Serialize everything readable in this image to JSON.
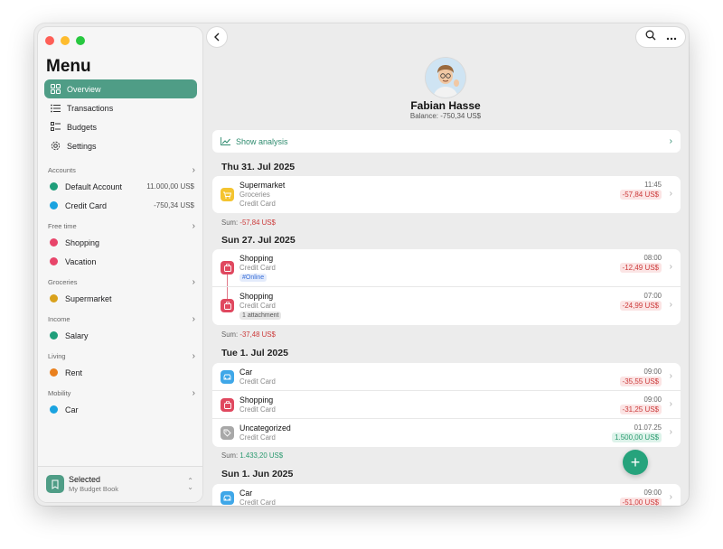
{
  "sidebar": {
    "title": "Menu",
    "nav": [
      {
        "label": "Overview",
        "icon": "grid-icon",
        "active": true
      },
      {
        "label": "Transactions",
        "icon": "list-icon"
      },
      {
        "label": "Budgets",
        "icon": "checklist-icon"
      },
      {
        "label": "Settings",
        "icon": "gear-icon"
      }
    ],
    "groups": [
      {
        "name": "Accounts",
        "items": [
          {
            "label": "Default Account",
            "amount": "11.000,00 US$",
            "color": "#1f9e7a"
          },
          {
            "label": "Credit Card",
            "amount": "-750,34 US$",
            "color": "#1aa3e0"
          }
        ]
      },
      {
        "name": "Free time",
        "items": [
          {
            "label": "Shopping",
            "color": "#e8456a"
          },
          {
            "label": "Vacation",
            "color": "#e8456a"
          }
        ]
      },
      {
        "name": "Groceries",
        "items": [
          {
            "label": "Supermarket",
            "color": "#d9a11c"
          }
        ]
      },
      {
        "name": "Income",
        "items": [
          {
            "label": "Salary",
            "color": "#1f9e7a"
          }
        ]
      },
      {
        "name": "Living",
        "items": [
          {
            "label": "Rent",
            "color": "#e9801e"
          }
        ]
      },
      {
        "name": "Mobility",
        "items": [
          {
            "label": "Car",
            "color": "#1aa3e0"
          }
        ]
      }
    ],
    "footer": {
      "title": "Selected",
      "subtitle": "My Budget Book"
    }
  },
  "profile": {
    "name": "Fabian Hasse",
    "balance": "Balance: -750,34 US$"
  },
  "analysis_label": "Show analysis",
  "days": [
    {
      "date": "Thu 31. Jul 2025",
      "sum_label": "Sum:",
      "sum": "-57,84 US$",
      "rows": [
        {
          "title": "Supermarket",
          "sub1": "Groceries",
          "sub2": "Credit Card",
          "time": "11:45",
          "amount": "-57,84 US$",
          "icon": "cart-icon"
        }
      ]
    },
    {
      "date": "Sun 27. Jul 2025",
      "sum_label": "Sum:",
      "sum": "-37,48 US$",
      "rows": [
        {
          "title": "Shopping",
          "sub1": "Credit Card",
          "tag": "#Online",
          "time": "08:00",
          "amount": "-12,49 US$",
          "icon": "bag-icon"
        },
        {
          "title": "Shopping",
          "sub1": "Credit Card",
          "tag": "1 attachment",
          "time": "07:00",
          "amount": "-24,99 US$",
          "icon": "bag-icon"
        }
      ]
    },
    {
      "date": "Tue 1. Jul 2025",
      "sum_label": "Sum:",
      "sum": "1.433,20 US$",
      "rows": [
        {
          "title": "Car",
          "sub1": "Credit Card",
          "time": "09:00",
          "amount": "-35,55 US$",
          "icon": "car-icon"
        },
        {
          "title": "Shopping",
          "sub1": "Credit Card",
          "time": "09:00",
          "amount": "-31,25 US$",
          "icon": "bag-icon"
        },
        {
          "title": "Uncategorized",
          "sub1": "Credit Card",
          "time": "01.07.25",
          "amount": "1.500,00 US$",
          "icon": "tag-icon"
        }
      ]
    },
    {
      "date": "Sun 1. Jun 2025",
      "rows": [
        {
          "title": "Car",
          "sub1": "Credit Card",
          "time": "09:00",
          "amount": "-51,00 US$",
          "icon": "car-icon"
        }
      ]
    }
  ],
  "colors": {
    "accent": "#4f9d86",
    "fab": "#26a37c",
    "negative": "#cc3b3b",
    "positive": "#2a9a6f"
  }
}
